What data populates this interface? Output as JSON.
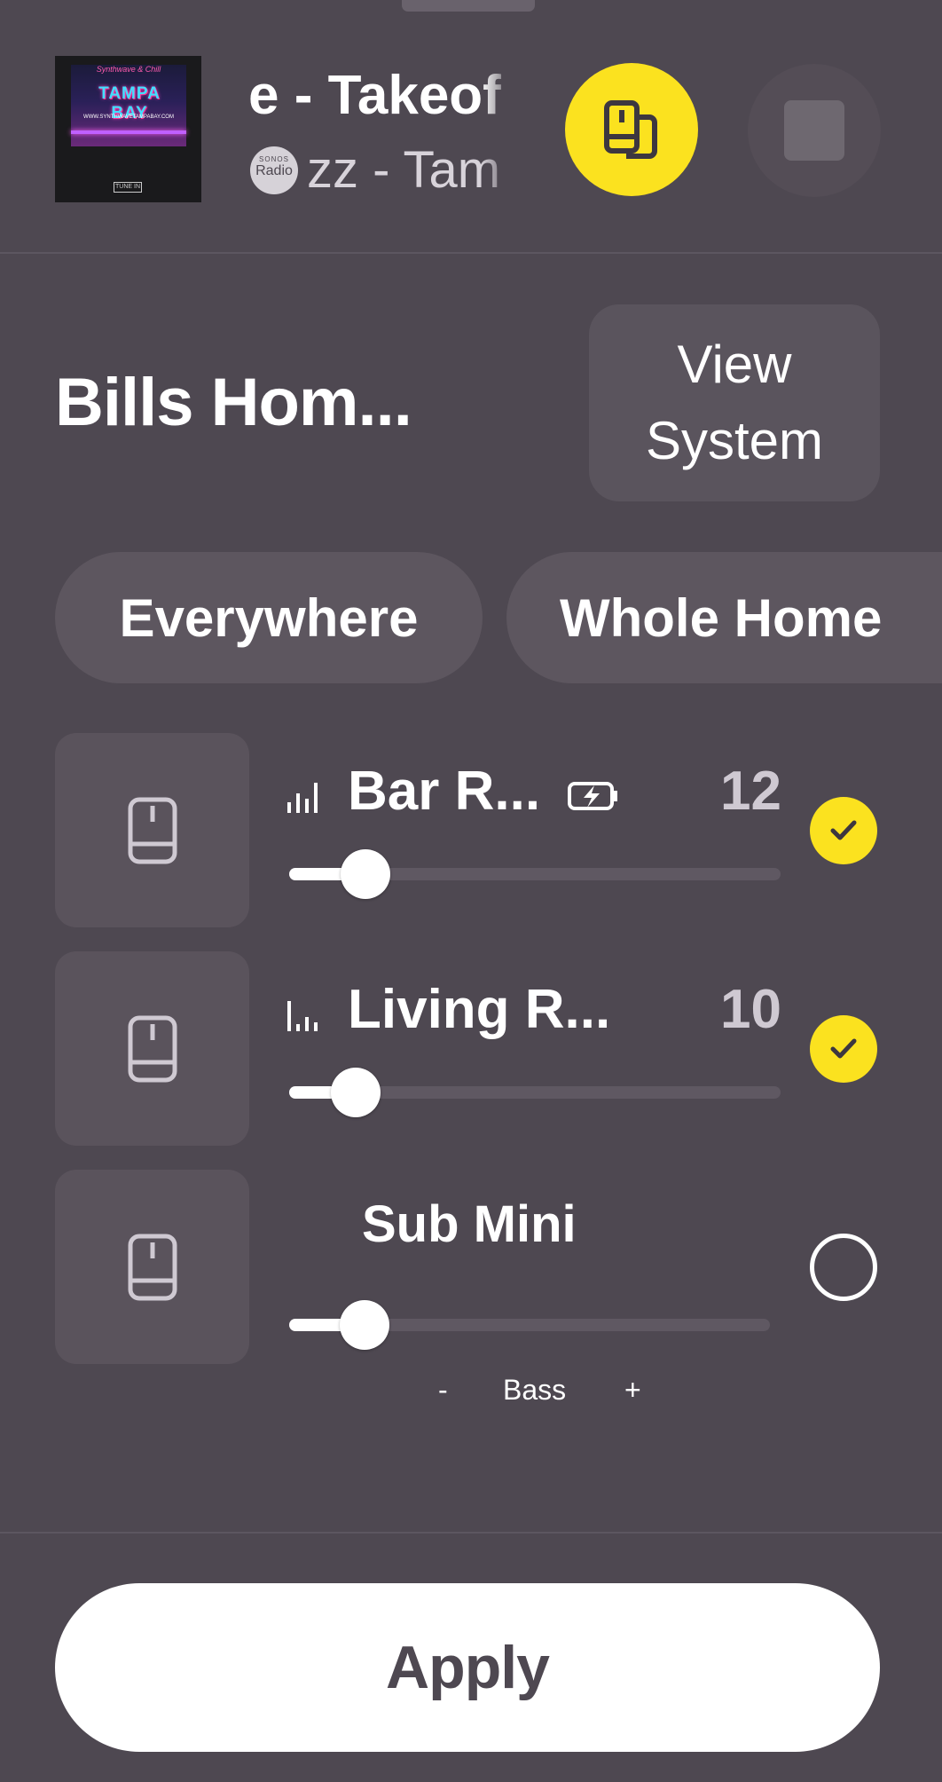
{
  "now_playing": {
    "album_art": {
      "top_text": "Synthwave & Chill",
      "title": "TAMPA BAY",
      "url": "WWW.SYNTHWAVETAMPABAY.COM",
      "logo": "TUNE IN"
    },
    "track_title": "e - Takeof",
    "track_subtitle": "zz - Tam",
    "source_badge": {
      "brand": "SONOS",
      "label": "Radio"
    },
    "groups_icon": "speaker-group-icon",
    "stop_icon": "stop-icon"
  },
  "system": {
    "title": "Bills Hom...",
    "view_system_line1": "View",
    "view_system_line2": "System"
  },
  "chips": [
    "Everywhere",
    "Whole Home"
  ],
  "rooms": [
    {
      "name": "Bar R...",
      "volume": "12",
      "volume_value": 12,
      "selected": true,
      "has_eq": true,
      "has_battery": true
    },
    {
      "name": "Living R...",
      "volume": "10",
      "volume_value": 10,
      "selected": true,
      "has_eq": true,
      "has_battery": false
    },
    {
      "name": "Sub Mini",
      "selected": false,
      "level": 0.12,
      "bass": {
        "minus": "-",
        "label": "Bass",
        "plus": "+"
      }
    }
  ],
  "apply_label": "Apply",
  "colors": {
    "background": "#4e4851",
    "accent": "#fbe21f",
    "tile": "#5a535c"
  }
}
